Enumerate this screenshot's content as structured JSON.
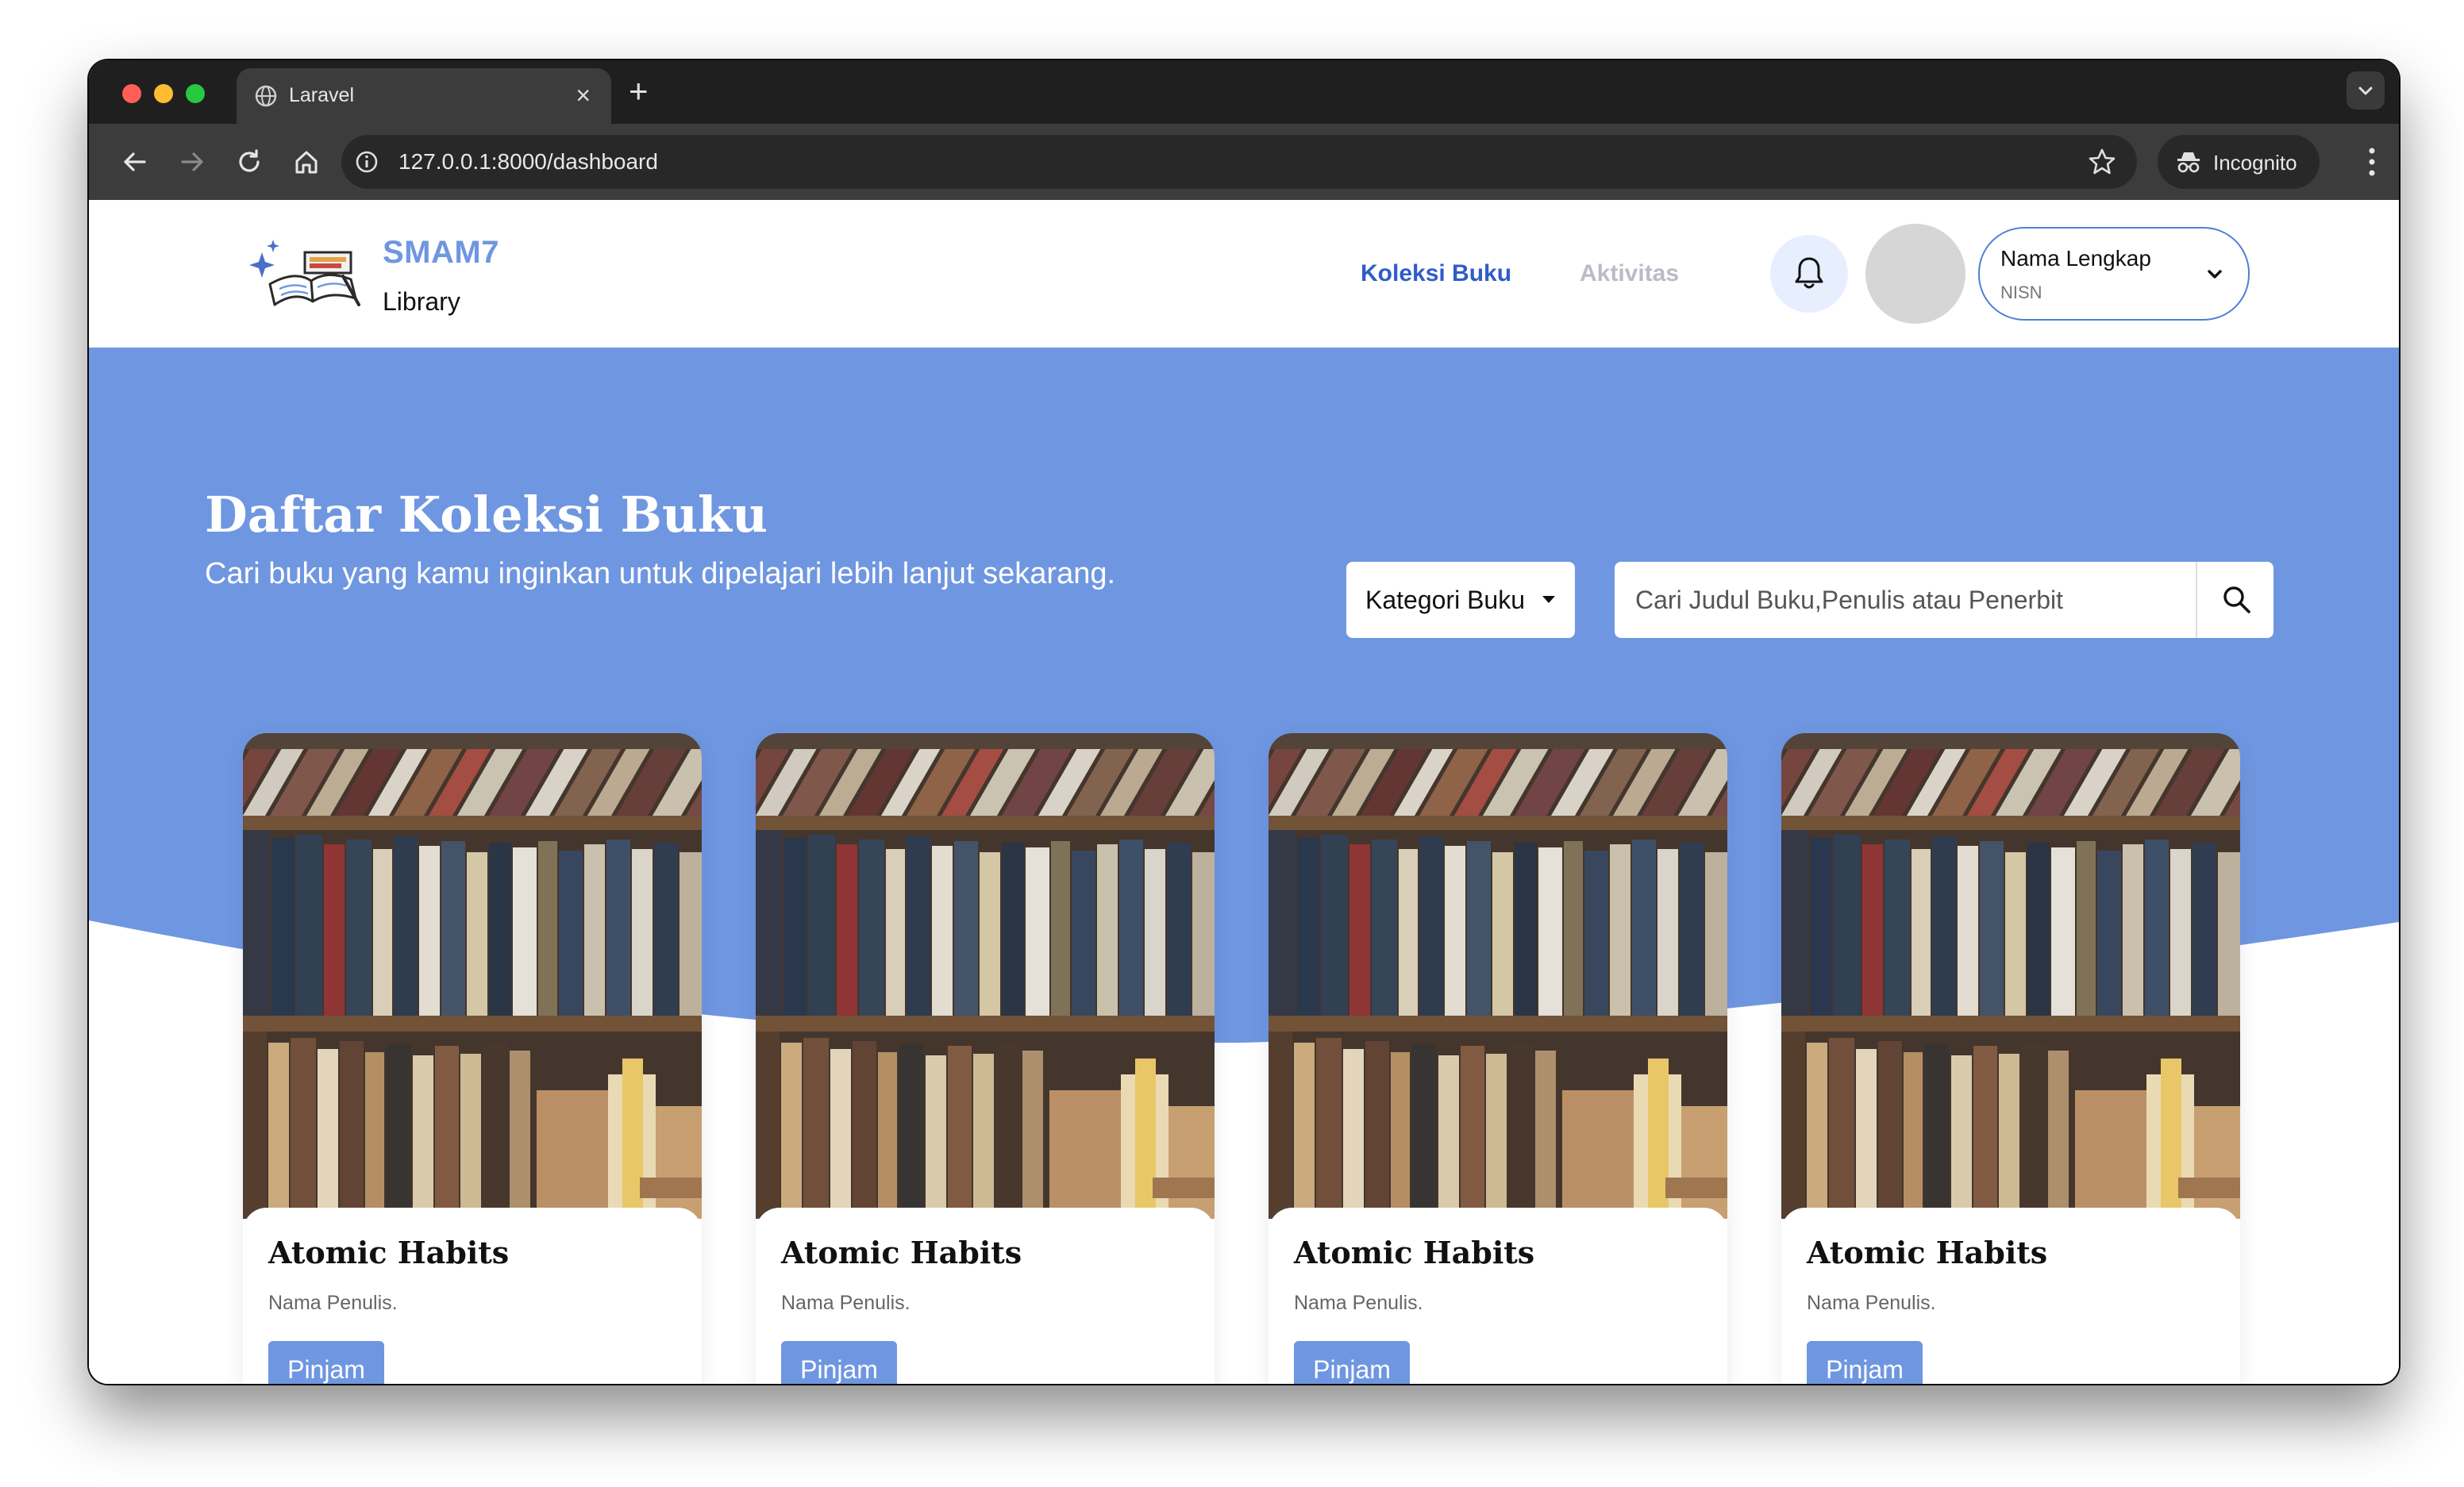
{
  "browser": {
    "tab_title": "Laravel",
    "tab_close": "×",
    "new_tab": "+",
    "url": "127.0.0.1:8000/dashboard",
    "incognito_label": "Incognito"
  },
  "navbar": {
    "brand_name": "SMAM7",
    "brand_sub": "Library",
    "links": [
      "Koleksi Buku",
      "Aktivitas"
    ],
    "user_name": "Nama Lengkap",
    "user_nisn": "NISN"
  },
  "hero": {
    "title": "Daftar Koleksi Buku",
    "subtitle": "Cari buku yang kamu inginkan untuk dipelajari lebih lanjut sekarang.",
    "kategori_label": "Kategori Buku",
    "search_placeholder": "Cari Judul Buku,Penulis atau Penerbit"
  },
  "books": [
    {
      "title": "Atomic Habits",
      "author": "Nama Penulis.",
      "button": "Pinjam"
    },
    {
      "title": "Atomic Habits",
      "author": "Nama Penulis.",
      "button": "Pinjam"
    },
    {
      "title": "Atomic Habits",
      "author": "Nama Penulis.",
      "button": "Pinjam"
    },
    {
      "title": "Atomic Habits",
      "author": "Nama Penulis.",
      "button": "Pinjam"
    }
  ],
  "colors": {
    "primary": "#6f96e0",
    "nav_active": "#2f5cc9",
    "nav_inactive": "#b9bcc6",
    "hero_bg": "#6f96e0"
  },
  "icons": {
    "tab": "globe-icon",
    "back": "back-arrow-icon",
    "forward": "forward-arrow-icon",
    "reload": "reload-icon",
    "home": "home-icon",
    "site_info": "info-icon",
    "bookmark": "star-icon",
    "incognito": "incognito-icon",
    "menu": "kebab-menu-icon",
    "notifications": "bell-icon",
    "search": "search-icon",
    "dropdown": "chevron-down-icon"
  }
}
